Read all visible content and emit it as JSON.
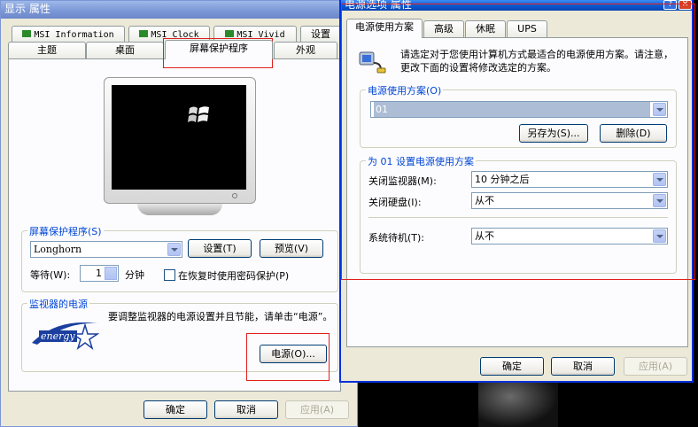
{
  "display_window": {
    "title": "显示 属性",
    "tabs_top": [
      "MSI Information",
      "MSI Clock",
      "MSI Vivid",
      "设置"
    ],
    "tabs_bottom": [
      "主题",
      "桌面",
      "屏幕保护程序",
      "外观"
    ],
    "screensaver_group_label": "屏幕保护程序(S)",
    "screensaver_value": "Longhorn",
    "settings_button": "设置(T)",
    "preview_button": "预览(V)",
    "wait_label": "等待(W):",
    "wait_value": "1",
    "minutes_label": "分钟",
    "password_checkbox_label": "在恢复时使用密码保护(P)",
    "monitor_power_group_label": "监视器的电源",
    "power_description": "要调整监视器的电源设置并且节能，请单击“电源”。",
    "energy_logo_text": "energy",
    "power_button": "电源(O)...",
    "ok_button": "确定",
    "cancel_button": "取消",
    "apply_button": "应用(A)"
  },
  "power_window": {
    "title": "电源选项 属性",
    "tabs": [
      "电源使用方案",
      "高级",
      "休眠",
      "UPS"
    ],
    "intro_text": "请选定对于您使用计算机方式最适合的电源使用方案。请注意，更改下面的设置将修改选定的方案。",
    "scheme_group_label": "电源使用方案(O)",
    "scheme_value": "01",
    "save_as_button": "另存为(S)...",
    "delete_button": "删除(D)",
    "settings_group_label": "为 01 设置电源使用方案",
    "monitor_off_label": "关闭监视器(M):",
    "monitor_off_value": "10 分钟之后",
    "harddisk_off_label": "关闭硬盘(I):",
    "harddisk_off_value": "从不",
    "standby_label": "系统待机(T):",
    "standby_value": "从不",
    "ok_button": "确定",
    "cancel_button": "取消",
    "apply_button": "应用(A)"
  }
}
